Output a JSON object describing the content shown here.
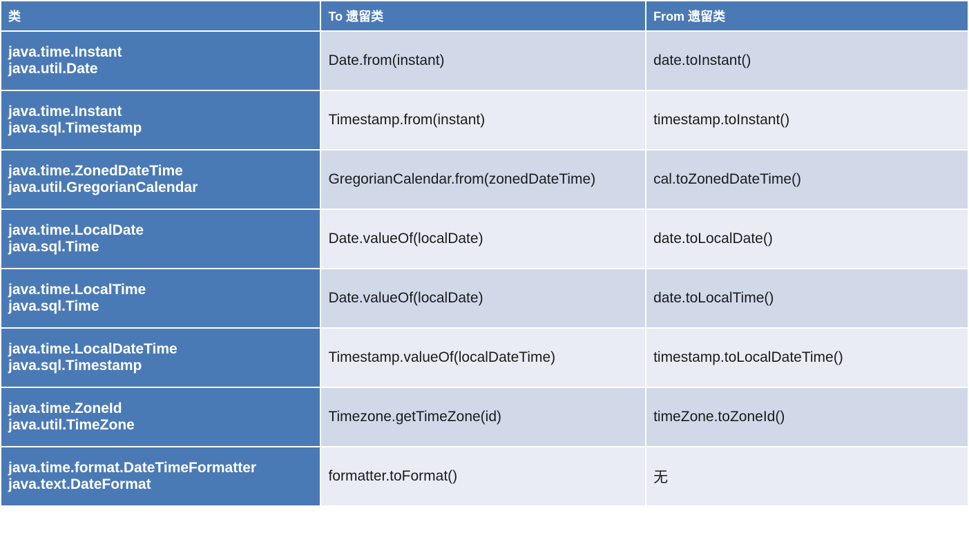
{
  "headers": {
    "col1": "类",
    "col2": "To 遗留类",
    "col3": "From 遗留类"
  },
  "rows": [
    {
      "class_pair": "java.time.Instant\njava.util.Date",
      "to_legacy": "Date.from(instant)",
      "from_legacy": "date.toInstant()"
    },
    {
      "class_pair": "java.time.Instant\njava.sql.Timestamp",
      "to_legacy": "Timestamp.from(instant)",
      "from_legacy": "timestamp.toInstant()"
    },
    {
      "class_pair": "java.time.ZonedDateTime\njava.util.GregorianCalendar",
      "to_legacy": "GregorianCalendar.from(zonedDateTime)",
      "from_legacy": "cal.toZonedDateTime()"
    },
    {
      "class_pair": "java.time.LocalDate\njava.sql.Time",
      "to_legacy": "Date.valueOf(localDate)",
      "from_legacy": "date.toLocalDate()"
    },
    {
      "class_pair": "java.time.LocalTime\njava.sql.Time",
      "to_legacy": "Date.valueOf(localDate)",
      "from_legacy": "date.toLocalTime()"
    },
    {
      "class_pair": "java.time.LocalDateTime\njava.sql.Timestamp",
      "to_legacy": "Timestamp.valueOf(localDateTime)",
      "from_legacy": "timestamp.toLocalDateTime()"
    },
    {
      "class_pair": "java.time.ZoneId\njava.util.TimeZone",
      "to_legacy": "Timezone.getTimeZone(id)",
      "from_legacy": "timeZone.toZoneId()"
    },
    {
      "class_pair": "java.time.format.DateTimeFormatter\njava.text.DateFormat",
      "to_legacy": "formatter.toFormat()",
      "from_legacy": "无"
    }
  ]
}
